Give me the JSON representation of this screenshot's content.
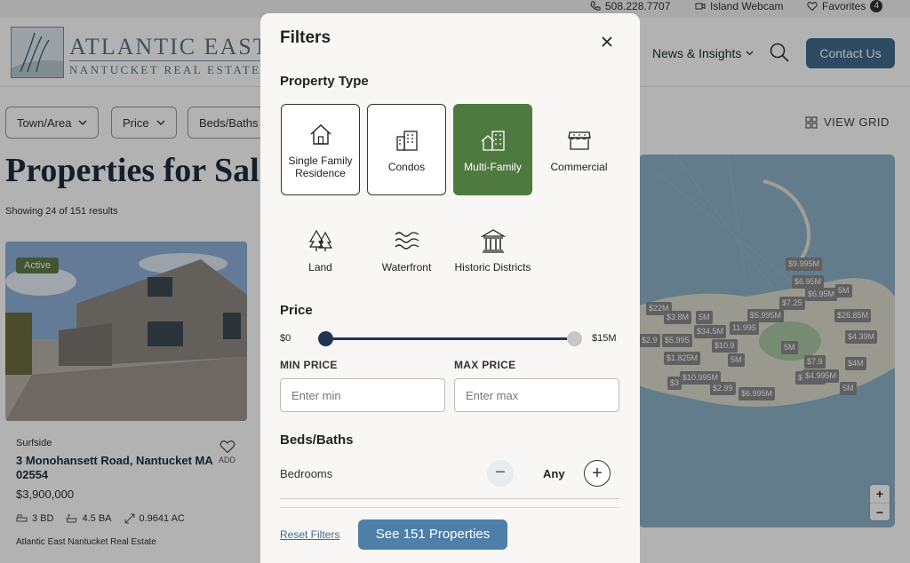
{
  "topbar": {
    "phone": "508.228.7707",
    "webcam": "Island Webcam",
    "favorites": "Favorites",
    "favorites_count": "4"
  },
  "header": {
    "logo_title": "ATLANTIC EAST",
    "logo_sub": "NANTUCKET REAL ESTATE",
    "nav_news": "News & Insights",
    "contact": "Contact Us"
  },
  "filterbar": {
    "town": "Town/Area",
    "price": "Price",
    "beds": "Beds/Baths",
    "view_grid": "VIEW GRID"
  },
  "page": {
    "title": "Properties for Sale",
    "showing": "Showing 24 of 151 results"
  },
  "card": {
    "badge": "Active",
    "area": "Surfside",
    "address": "3 Monohansett Road, Nantucket MA 02554",
    "price": "$3,900,000",
    "beds": "3 BD",
    "baths": "4.5 BA",
    "acres": "0.9641 AC",
    "agency": "Atlantic East Nantucket Real Estate",
    "fav_label": "ADD"
  },
  "map": {
    "pins": [
      "$9.995M",
      "$6.95M",
      "$6.95M",
      "5M",
      "$7.25",
      "$22M",
      "$3.8M",
      "5M",
      "$5.995M",
      "$26.85M",
      "11.995",
      "$34.5M",
      "$4.39M",
      "$2.9",
      "$5.995",
      "$10.9",
      "5M",
      "5M",
      "$1.825M",
      "$7.9",
      "$4M",
      "$10.995M",
      "$4.595",
      "$4.995M",
      "$3",
      "$2.99",
      "$6.995M",
      "5M"
    ],
    "zoom_in": "+",
    "zoom_out": "−"
  },
  "modal": {
    "title": "Filters",
    "property_type_heading": "Property Type",
    "types": [
      {
        "label": "Single Family Residence",
        "icon": "house-icon",
        "selected": false
      },
      {
        "label": "Condos",
        "icon": "building-icon",
        "selected": false
      },
      {
        "label": "Multi-Family",
        "icon": "multi-family-icon",
        "selected": true
      },
      {
        "label": "Commercial",
        "icon": "storefront-icon",
        "selected": false
      },
      {
        "label": "Land",
        "icon": "trees-icon",
        "selected": false
      },
      {
        "label": "Waterfront",
        "icon": "waves-icon",
        "selected": false
      },
      {
        "label": "Historic Districts",
        "icon": "historic-building-icon",
        "selected": false
      }
    ],
    "price_heading": "Price",
    "price_min_label": "$0",
    "price_max_label": "$15M",
    "min_price_label": "MIN PRICE",
    "max_price_label": "MAX PRICE",
    "min_placeholder": "Enter min",
    "max_placeholder": "Enter max",
    "beds_heading": "Beds/Baths",
    "bedrooms_label": "Bedrooms",
    "bedrooms_value": "Any",
    "reset": "Reset Filters",
    "see": "See 151 Properties"
  },
  "colors": {
    "accent_blue": "#4d7fa8",
    "selected_green": "#4e7a40",
    "slider_navy": "#1f3552"
  }
}
